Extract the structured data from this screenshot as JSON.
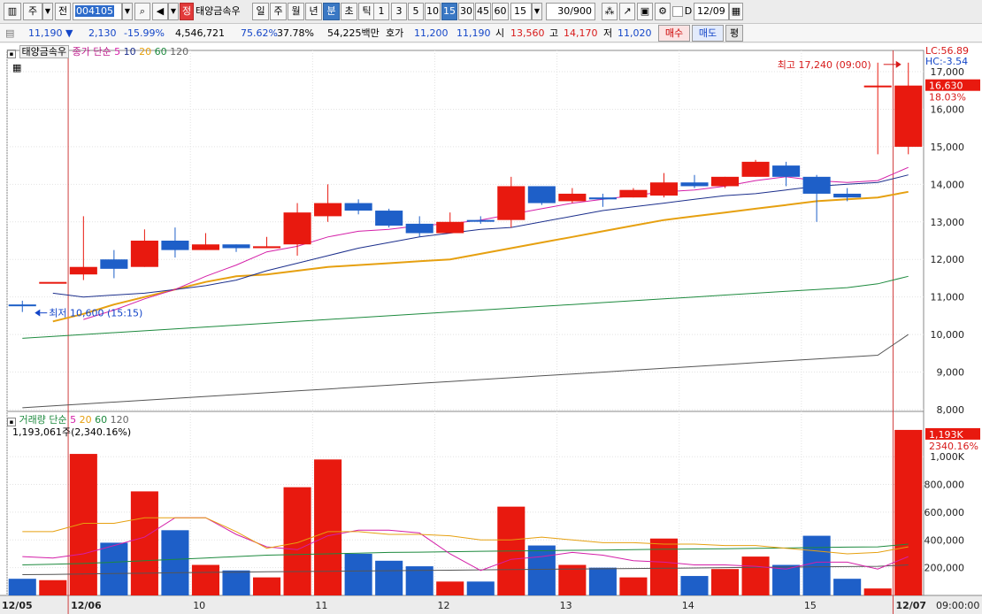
{
  "toolbar": {
    "type_label": "주",
    "market_label": "전",
    "code": "004105",
    "order_badge": "정",
    "stock_name": "태양금속우",
    "periods": [
      "일",
      "주",
      "월",
      "년",
      "분",
      "초",
      "틱"
    ],
    "active_period": "분",
    "intervals": [
      "1",
      "3",
      "5",
      "10",
      "15",
      "30",
      "45",
      "60"
    ],
    "active_interval": "15",
    "interval_select": "15",
    "count_display": "30/900",
    "checkbox_label": "D",
    "date_value": "12/09"
  },
  "quote": {
    "price": "11,190",
    "change": "2,130",
    "change_rate": "-15.99%",
    "volume": "4,546,721",
    "ratio1": "75.62%",
    "ratio2": "37.78%",
    "amount": "54,225백만",
    "ask_label": "호가",
    "ask": "11,200",
    "bid": "11,190",
    "open_label": "시",
    "open": "13,560",
    "high_label": "고",
    "high": "14,170",
    "low_label": "저",
    "low": "11,020",
    "buy_label": "매수",
    "sell_label": "매도",
    "flat_label": "평"
  },
  "price_panel": {
    "name_tag": "태양금속우",
    "legend_prefix": "종가 단순",
    "ma_labels": [
      "5",
      "10",
      "20",
      "60",
      "120"
    ],
    "lc_label": "LC:56.89",
    "hc_label": "HC:-3.54",
    "price_box": "16,630",
    "price_box_pct": "18.03%",
    "max_annotation": "최고 17,240 (09:00)",
    "min_annotation": "최저 10,600 (15:15)"
  },
  "volume_panel": {
    "legend_prefix": "거래량 단순",
    "ma_labels": [
      "5",
      "20",
      "60",
      "120"
    ],
    "current_info": "1,193,061주(2,340.16%)",
    "vol_box": "1,193K",
    "vol_box_pct": "2340.16%"
  },
  "colors": {
    "up": "#e8190f",
    "down": "#1e5fc8",
    "ma5": "#d41fa8",
    "ma10": "#1c2f8c",
    "ma20": "#e6a010",
    "ma60": "#1d8a3e",
    "ma120": "#666666",
    "vline": "#d04040"
  },
  "chart_data": {
    "type": "candlestick",
    "price_axis": {
      "min": 8000,
      "max": 17000,
      "ticks": [
        "8,000",
        "9,000",
        "10,000",
        "11,000",
        "12,000",
        "13,000",
        "14,000",
        "15,000",
        "16,000",
        "17,000"
      ]
    },
    "volume_axis": {
      "ticks": [
        "200,000",
        "400,000",
        "600,000",
        "800,000",
        "1,000K"
      ]
    },
    "x_labels": [
      "12/05",
      "12/06",
      "10",
      "11",
      "12",
      "13",
      "14",
      "15",
      "12/07"
    ],
    "x_label_index": [
      0,
      2,
      6,
      10,
      14,
      18,
      22,
      26,
      29
    ],
    "time_label": "09:00:00",
    "candles": [
      {
        "o": 10800,
        "h": 10900,
        "l": 10600,
        "c": 10800
      },
      {
        "o": 11400,
        "h": 11400,
        "l": 11400,
        "c": 11400
      },
      {
        "o": 11600,
        "h": 13150,
        "l": 11450,
        "c": 11800
      },
      {
        "o": 12000,
        "h": 12250,
        "l": 11500,
        "c": 11750
      },
      {
        "o": 11800,
        "h": 12800,
        "l": 11800,
        "c": 12500
      },
      {
        "o": 12500,
        "h": 12850,
        "l": 12050,
        "c": 12250
      },
      {
        "o": 12250,
        "h": 12700,
        "l": 12250,
        "c": 12400
      },
      {
        "o": 12400,
        "h": 12400,
        "l": 12200,
        "c": 12300
      },
      {
        "o": 12300,
        "h": 12600,
        "l": 12300,
        "c": 12350
      },
      {
        "o": 12400,
        "h": 13500,
        "l": 12100,
        "c": 13250
      },
      {
        "o": 13150,
        "h": 14000,
        "l": 13000,
        "c": 13500
      },
      {
        "o": 13500,
        "h": 13600,
        "l": 13200,
        "c": 13300
      },
      {
        "o": 13300,
        "h": 13350,
        "l": 12850,
        "c": 12900
      },
      {
        "o": 12950,
        "h": 13150,
        "l": 12600,
        "c": 12700
      },
      {
        "o": 12700,
        "h": 13250,
        "l": 12700,
        "c": 13000
      },
      {
        "o": 13050,
        "h": 13150,
        "l": 12950,
        "c": 13050
      },
      {
        "o": 13050,
        "h": 14200,
        "l": 12850,
        "c": 13950
      },
      {
        "o": 13950,
        "h": 13950,
        "l": 13450,
        "c": 13500
      },
      {
        "o": 13550,
        "h": 13900,
        "l": 13500,
        "c": 13750
      },
      {
        "o": 13650,
        "h": 13750,
        "l": 13400,
        "c": 13600
      },
      {
        "o": 13650,
        "h": 13900,
        "l": 13650,
        "c": 13850
      },
      {
        "o": 13700,
        "h": 14300,
        "l": 13650,
        "c": 14050
      },
      {
        "o": 14050,
        "h": 14250,
        "l": 13900,
        "c": 13950
      },
      {
        "o": 13950,
        "h": 14200,
        "l": 13900,
        "c": 14200
      },
      {
        "o": 14200,
        "h": 14650,
        "l": 14200,
        "c": 14600
      },
      {
        "o": 14500,
        "h": 14600,
        "l": 13950,
        "c": 14200
      },
      {
        "o": 14200,
        "h": 14250,
        "l": 13000,
        "c": 13750
      },
      {
        "o": 13750,
        "h": 13900,
        "l": 13550,
        "c": 13650
      },
      {
        "o": 16630,
        "h": 17240,
        "l": 14800,
        "c": 16630
      },
      {
        "o": 15000,
        "h": 17240,
        "l": 14800,
        "c": 16630
      }
    ],
    "candle_dir": [
      "d",
      "u",
      "u",
      "d",
      "u",
      "d",
      "u",
      "d",
      "u",
      "u",
      "u",
      "d",
      "d",
      "d",
      "u",
      "d",
      "u",
      "d",
      "u",
      "d",
      "u",
      "u",
      "d",
      "u",
      "u",
      "d",
      "d",
      "d",
      "u",
      "u"
    ],
    "ma5": [
      null,
      null,
      10400,
      10650,
      10950,
      11200,
      11550,
      11850,
      12200,
      12350,
      12600,
      12750,
      12800,
      12900,
      12950,
      13050,
      13200,
      13350,
      13500,
      13600,
      13700,
      13800,
      13850,
      13950,
      14100,
      14200,
      14100,
      14050,
      14100,
      14450
    ],
    "ma10": [
      null,
      11100,
      11000,
      11050,
      11100,
      11200,
      11300,
      11450,
      11700,
      11900,
      12100,
      12300,
      12450,
      12600,
      12700,
      12800,
      12850,
      13000,
      13150,
      13300,
      13400,
      13500,
      13600,
      13700,
      13750,
      13850,
      13950,
      14000,
      14050,
      14250
    ],
    "ma20": [
      null,
      10350,
      10550,
      10800,
      11000,
      11200,
      11400,
      11550,
      11600,
      11700,
      11800,
      11850,
      11900,
      11950,
      12000,
      12150,
      12300,
      12450,
      12600,
      12750,
      12900,
      13050,
      13150,
      13250,
      13350,
      13450,
      13550,
      13600,
      13650,
      13800
    ],
    "ma60": [
      9900,
      9950,
      10000,
      10050,
      10100,
      10150,
      10200,
      10250,
      10300,
      10350,
      10400,
      10450,
      10500,
      10550,
      10600,
      10650,
      10700,
      10750,
      10800,
      10850,
      10900,
      10950,
      11000,
      11050,
      11100,
      11150,
      11200,
      11250,
      11350,
      11550
    ],
    "ma120": [
      8050,
      8100,
      8150,
      8200,
      8250,
      8300,
      8350,
      8400,
      8450,
      8500,
      8550,
      8600,
      8650,
      8700,
      8750,
      8800,
      8850,
      8900,
      8950,
      9000,
      9050,
      9100,
      9150,
      9200,
      9250,
      9300,
      9350,
      9400,
      9450,
      10000
    ],
    "volume": [
      120000,
      110000,
      1020000,
      380000,
      750000,
      470000,
      220000,
      180000,
      130000,
      780000,
      980000,
      300000,
      250000,
      210000,
      100000,
      100000,
      640000,
      360000,
      220000,
      200000,
      130000,
      410000,
      140000,
      190000,
      280000,
      220000,
      430000,
      120000,
      50000,
      1193061
    ],
    "vol_ma5": [
      460000,
      460000,
      520000,
      520000,
      560000,
      560000,
      560000,
      460000,
      340000,
      380000,
      460000,
      460000,
      440000,
      440000,
      430000,
      400000,
      400000,
      420000,
      400000,
      380000,
      380000,
      370000,
      370000,
      360000,
      360000,
      340000,
      320000,
      300000,
      310000,
      350000
    ],
    "vol_ma20": [
      280000,
      270000,
      300000,
      360000,
      420000,
      560000,
      560000,
      440000,
      350000,
      330000,
      430000,
      470000,
      470000,
      450000,
      300000,
      180000,
      260000,
      280000,
      310000,
      290000,
      250000,
      240000,
      220000,
      220000,
      210000,
      190000,
      240000,
      240000,
      190000,
      280000
    ],
    "vol_ma60": [
      220000,
      225000,
      230000,
      240000,
      250000,
      260000,
      270000,
      280000,
      290000,
      295000,
      300000,
      305000,
      310000,
      312000,
      315000,
      318000,
      320000,
      322000,
      325000,
      327000,
      330000,
      333000,
      335000,
      337000,
      340000,
      342000,
      345000,
      348000,
      350000,
      370000
    ],
    "vol_ma120": [
      150000,
      152000,
      155000,
      158000,
      160000,
      163000,
      166000,
      168000,
      170000,
      172000,
      174000,
      176000,
      178000,
      180000,
      182000,
      184000,
      186000,
      188000,
      190000,
      192000,
      194000,
      196000,
      198000,
      200000,
      202000,
      204000,
      206000,
      208000,
      210000,
      220000
    ]
  }
}
